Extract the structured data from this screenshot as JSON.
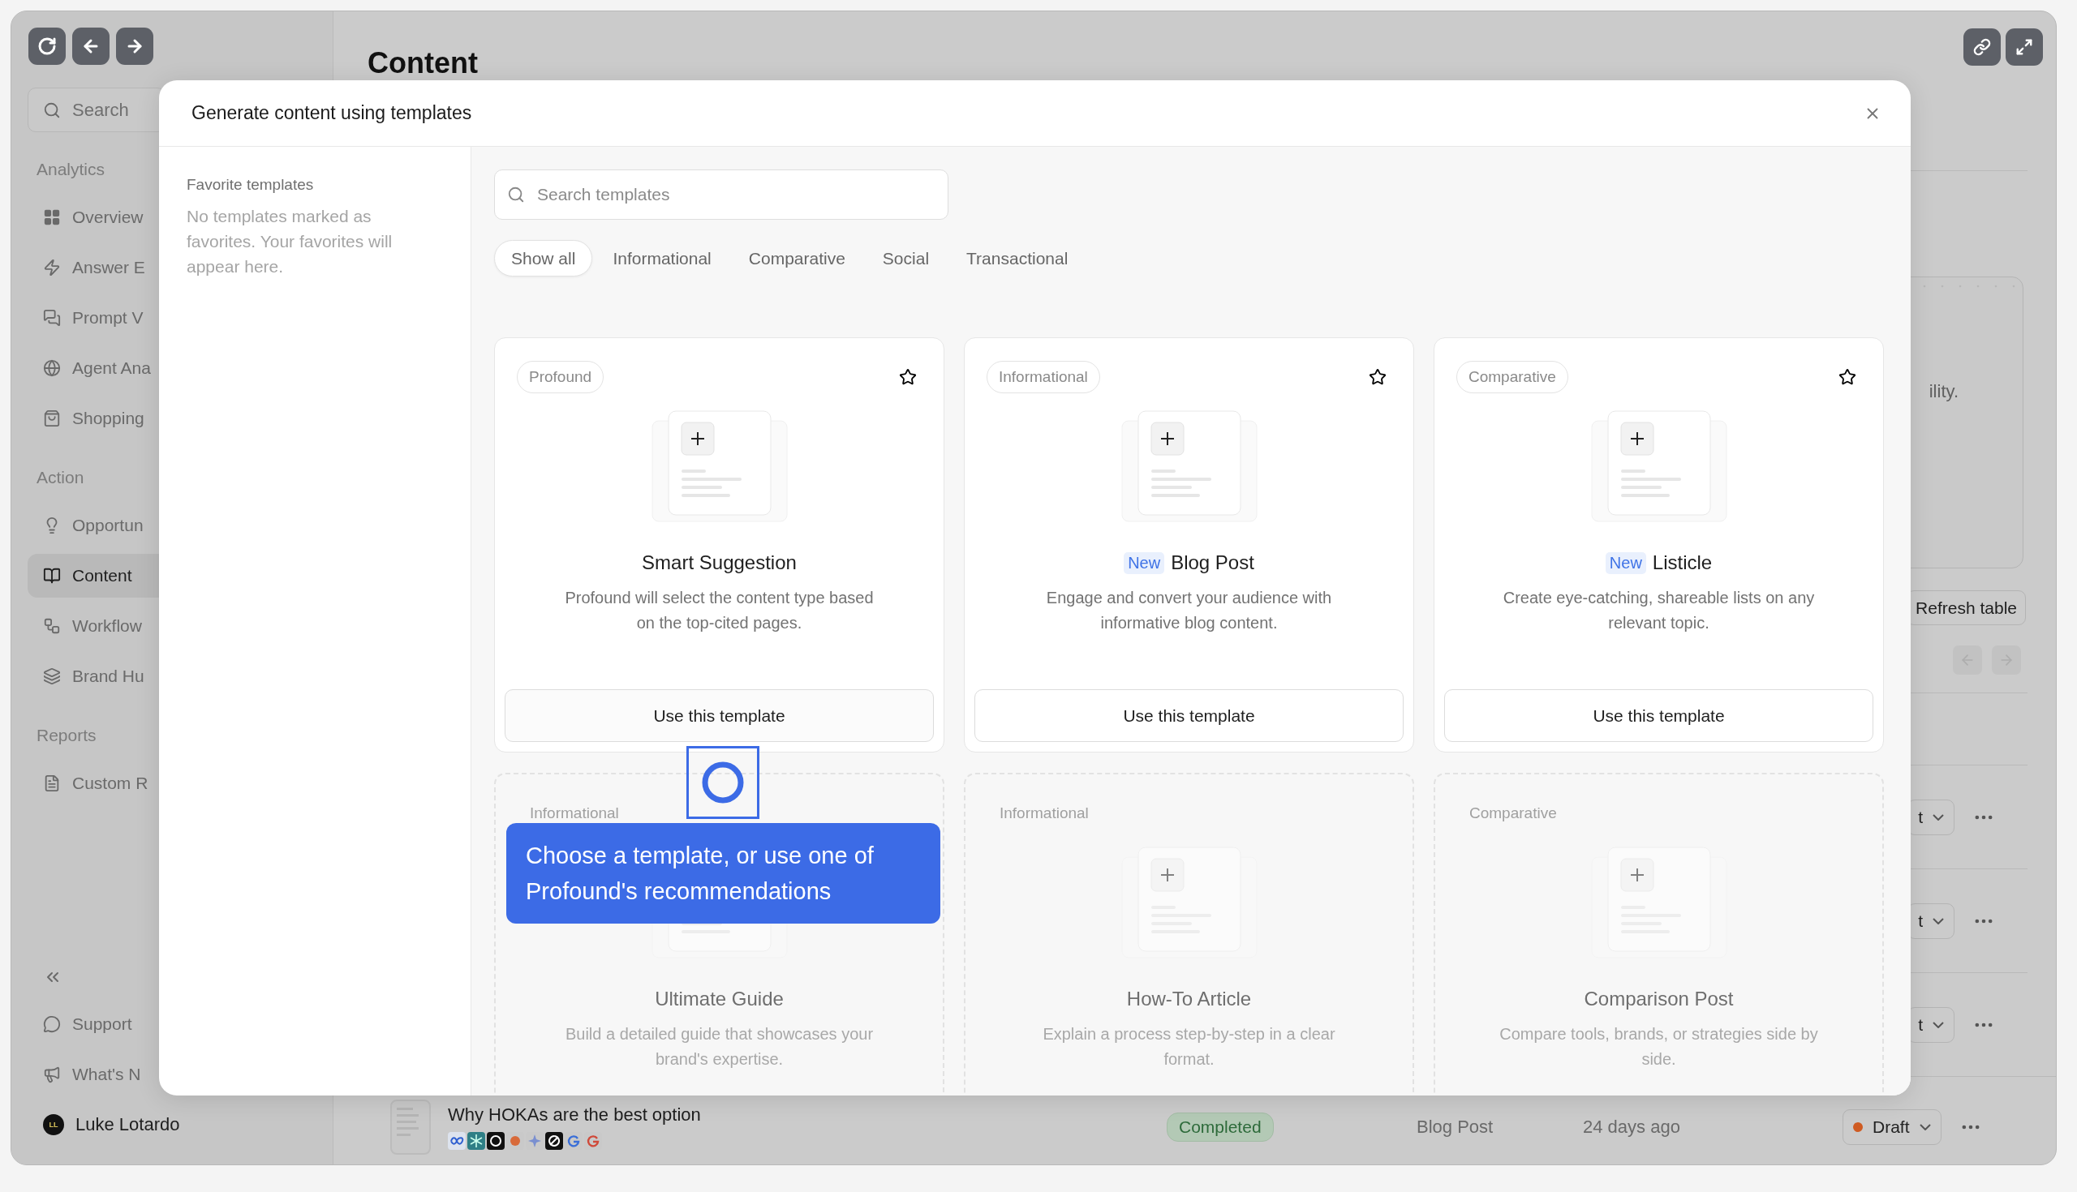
{
  "sidebar": {
    "search_placeholder": "Search",
    "sections": [
      {
        "heading": "Analytics",
        "items": [
          {
            "label": "Overview",
            "selected": false
          },
          {
            "label": "Answer E",
            "selected": false
          },
          {
            "label": "Prompt V",
            "selected": false
          },
          {
            "label": "Agent Ana",
            "selected": false
          },
          {
            "label": "Shopping",
            "selected": false
          }
        ]
      },
      {
        "heading": "Action",
        "items": [
          {
            "label": "Opportun",
            "selected": false
          },
          {
            "label": "Content",
            "selected": true
          },
          {
            "label": "Workflow",
            "selected": false
          },
          {
            "label": "Brand Hu",
            "selected": false
          }
        ]
      },
      {
        "heading": "Reports",
        "items": [
          {
            "label": "Custom R",
            "selected": false
          }
        ]
      }
    ],
    "footer_items": [
      {
        "label": "Support"
      },
      {
        "label": "What's N"
      }
    ],
    "user": {
      "initials": "LL",
      "name": "Luke Lotardo"
    }
  },
  "page": {
    "title": "Content",
    "card_text": "ility.",
    "refresh_button": "Refresh table",
    "row_status_fragments": [
      "t",
      "t",
      "t"
    ],
    "bottom_row": {
      "title": "Why HOKAs are the best option",
      "status": "Completed",
      "type": "Blog Post",
      "time": "24 days ago",
      "state": "Draft"
    }
  },
  "modal": {
    "title": "Generate content using templates",
    "favorites": {
      "heading": "Favorite templates",
      "empty_text": "No templates marked as favorites. Your favorites will appear here."
    },
    "search": {
      "placeholder": "Search templates"
    },
    "filters": [
      {
        "label": "Show all",
        "selected": true
      },
      {
        "label": "Informational",
        "selected": false
      },
      {
        "label": "Comparative",
        "selected": false
      },
      {
        "label": "Social",
        "selected": false
      },
      {
        "label": "Transactional",
        "selected": false
      }
    ],
    "templates": [
      {
        "tag": "Profound",
        "title": "Smart Suggestion",
        "description": "Profound will select the content type based on the top-cited pages.",
        "button": "Use this template",
        "disabled": false
      },
      {
        "tag": "Informational",
        "badge": "New",
        "title": "Blog Post",
        "description": "Engage and convert your audience with informative blog content.",
        "button": "Use this template",
        "disabled": false
      },
      {
        "tag": "Comparative",
        "badge": "New",
        "title": "Listicle",
        "description": "Create eye-catching, shareable lists on any relevant topic.",
        "button": "Use this template",
        "disabled": false
      },
      {
        "tag": "Informational",
        "title": "Ultimate Guide",
        "description": "Build a detailed guide that showcases your brand's expertise.",
        "disabled": true
      },
      {
        "tag": "Informational",
        "title": "How-To Article",
        "description": "Explain a process step-by-step in a clear format.",
        "disabled": true
      },
      {
        "tag": "Comparative",
        "title": "Comparison Post",
        "description": "Compare tools, brands, or strategies side by side.",
        "disabled": true
      }
    ],
    "tooltip": {
      "text": "Choose a template, or use one of Profound's recommendations"
    }
  }
}
